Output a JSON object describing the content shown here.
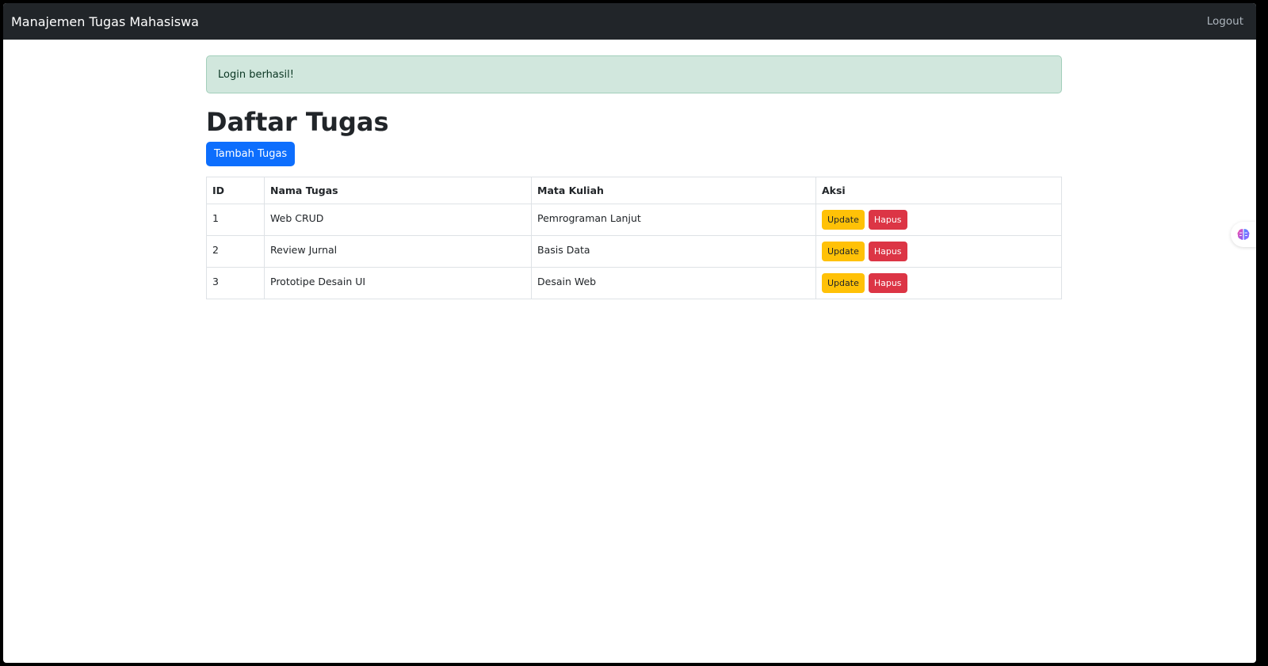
{
  "navbar": {
    "brand": "Manajemen Tugas Mahasiswa",
    "logout_label": "Logout"
  },
  "alert": {
    "message": "Login berhasil!"
  },
  "page": {
    "title": "Daftar Tugas",
    "add_button_label": "Tambah Tugas"
  },
  "table": {
    "headers": [
      "ID",
      "Nama Tugas",
      "Mata Kuliah",
      "Aksi"
    ],
    "rows": [
      {
        "id": "1",
        "nama": "Web CRUD",
        "mata_kuliah": "Pemrograman Lanjut"
      },
      {
        "id": "2",
        "nama": "Review Jurnal",
        "mata_kuliah": "Basis Data"
      },
      {
        "id": "3",
        "nama": "Prototipe Desain UI",
        "mata_kuliah": "Desain Web"
      }
    ],
    "update_label": "Update",
    "delete_label": "Hapus"
  },
  "icons": {
    "side_widget": "brain-icon"
  },
  "colors": {
    "navbar_bg": "#212529",
    "primary": "#0d6efd",
    "warning": "#ffc107",
    "danger": "#dc3545",
    "success_bg": "#d1e7dd"
  }
}
